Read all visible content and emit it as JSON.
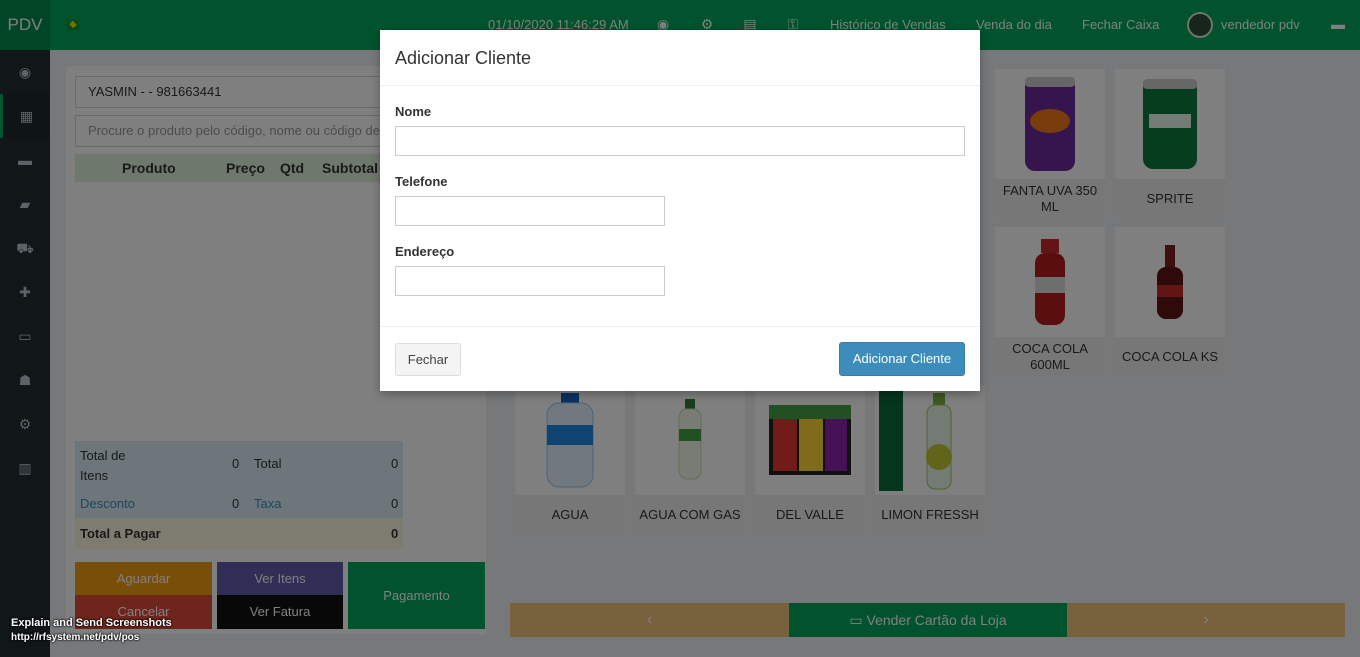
{
  "topbar": {
    "logo": "PDV",
    "datetime": "01/10/2020 11:46:29 AM",
    "links": [
      "Histórico de Vendas",
      "Venda do dia",
      "Fechar Caixa"
    ],
    "user_name": "vendedor pdv"
  },
  "left": {
    "client_value": "YASMIN - - 981663441",
    "search_placeholder": "Procure o produto pelo código, nome ou código de barras",
    "table_headers": [
      "Produto",
      "Preço",
      "Qtd",
      "Subtotal"
    ],
    "totals": {
      "total_itens_label": "Total de Itens",
      "total_itens_value": "0",
      "total_label": "Total",
      "total_value": "0",
      "desconto_label": "Desconto",
      "desconto_value": "0",
      "taxa_label": "Taxa",
      "taxa_value": "0",
      "pagar_label": "Total a Pagar",
      "pagar_value": "0"
    },
    "buttons": {
      "aguardar": "Aguardar",
      "ver_itens": "Ver Itens",
      "pagamento": "Pagamento",
      "cancelar": "Cancelar",
      "ver_fatura": "Ver Fatura"
    }
  },
  "products": {
    "row1": [
      "FANTA UVA 350 ML",
      "SPRITE"
    ],
    "row2": [
      "COCA COLA 600ML",
      "COCA COLA KS"
    ],
    "row3": [
      "AGUA",
      "AGUA COM GAS",
      "DEL VALLE",
      "LIMON FRESSH"
    ]
  },
  "bottom_bar": {
    "store_card": "Vender Cartão da Loja"
  },
  "modal": {
    "title": "Adicionar Cliente",
    "nome_label": "Nome",
    "telefone_label": "Telefone",
    "endereco_label": "Endereço",
    "close_button": "Fechar",
    "submit_button": "Adicionar Cliente"
  },
  "footer": {
    "line1": "Explain and Send Screenshots",
    "line2": "http://rfsystem.net/pdv/pos"
  },
  "colors": {
    "topbar": "#00a65a",
    "sidebar": "#222d32",
    "primary": "#3c8dbc",
    "aguardar": "#f39c12",
    "ver_itens": "#605ca8",
    "cancelar": "#dd4b39",
    "ver_fatura": "#111111",
    "pagamento": "#00a65a",
    "bottom_bar": "#f0c27b"
  }
}
